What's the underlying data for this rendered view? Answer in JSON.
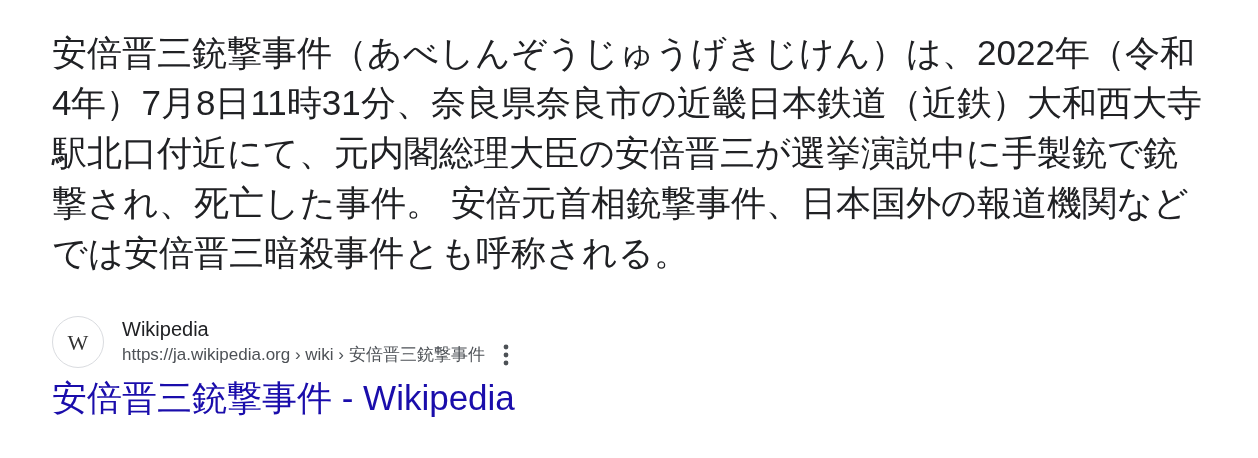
{
  "snippet": "安倍晋三銃撃事件（あべしんぞうじゅうげきじけん）は、2022年（令和4年）7月8日11時31分、奈良県奈良市の近畿日本鉄道（近鉄）大和西大寺駅北口付近にて、元内閣総理大臣の安倍晋三が選挙演説中に手製銃で銃撃され、死亡した事件。 安倍元首相銃撃事件、日本国外の報道機関などでは安倍晋三暗殺事件とも呼称される。",
  "source": {
    "favicon": "W",
    "name": "Wikipedia",
    "url": "https://ja.wikipedia.org › wiki › 安倍晋三銃撃事件"
  },
  "title": "安倍晋三銃撃事件 - Wikipedia"
}
